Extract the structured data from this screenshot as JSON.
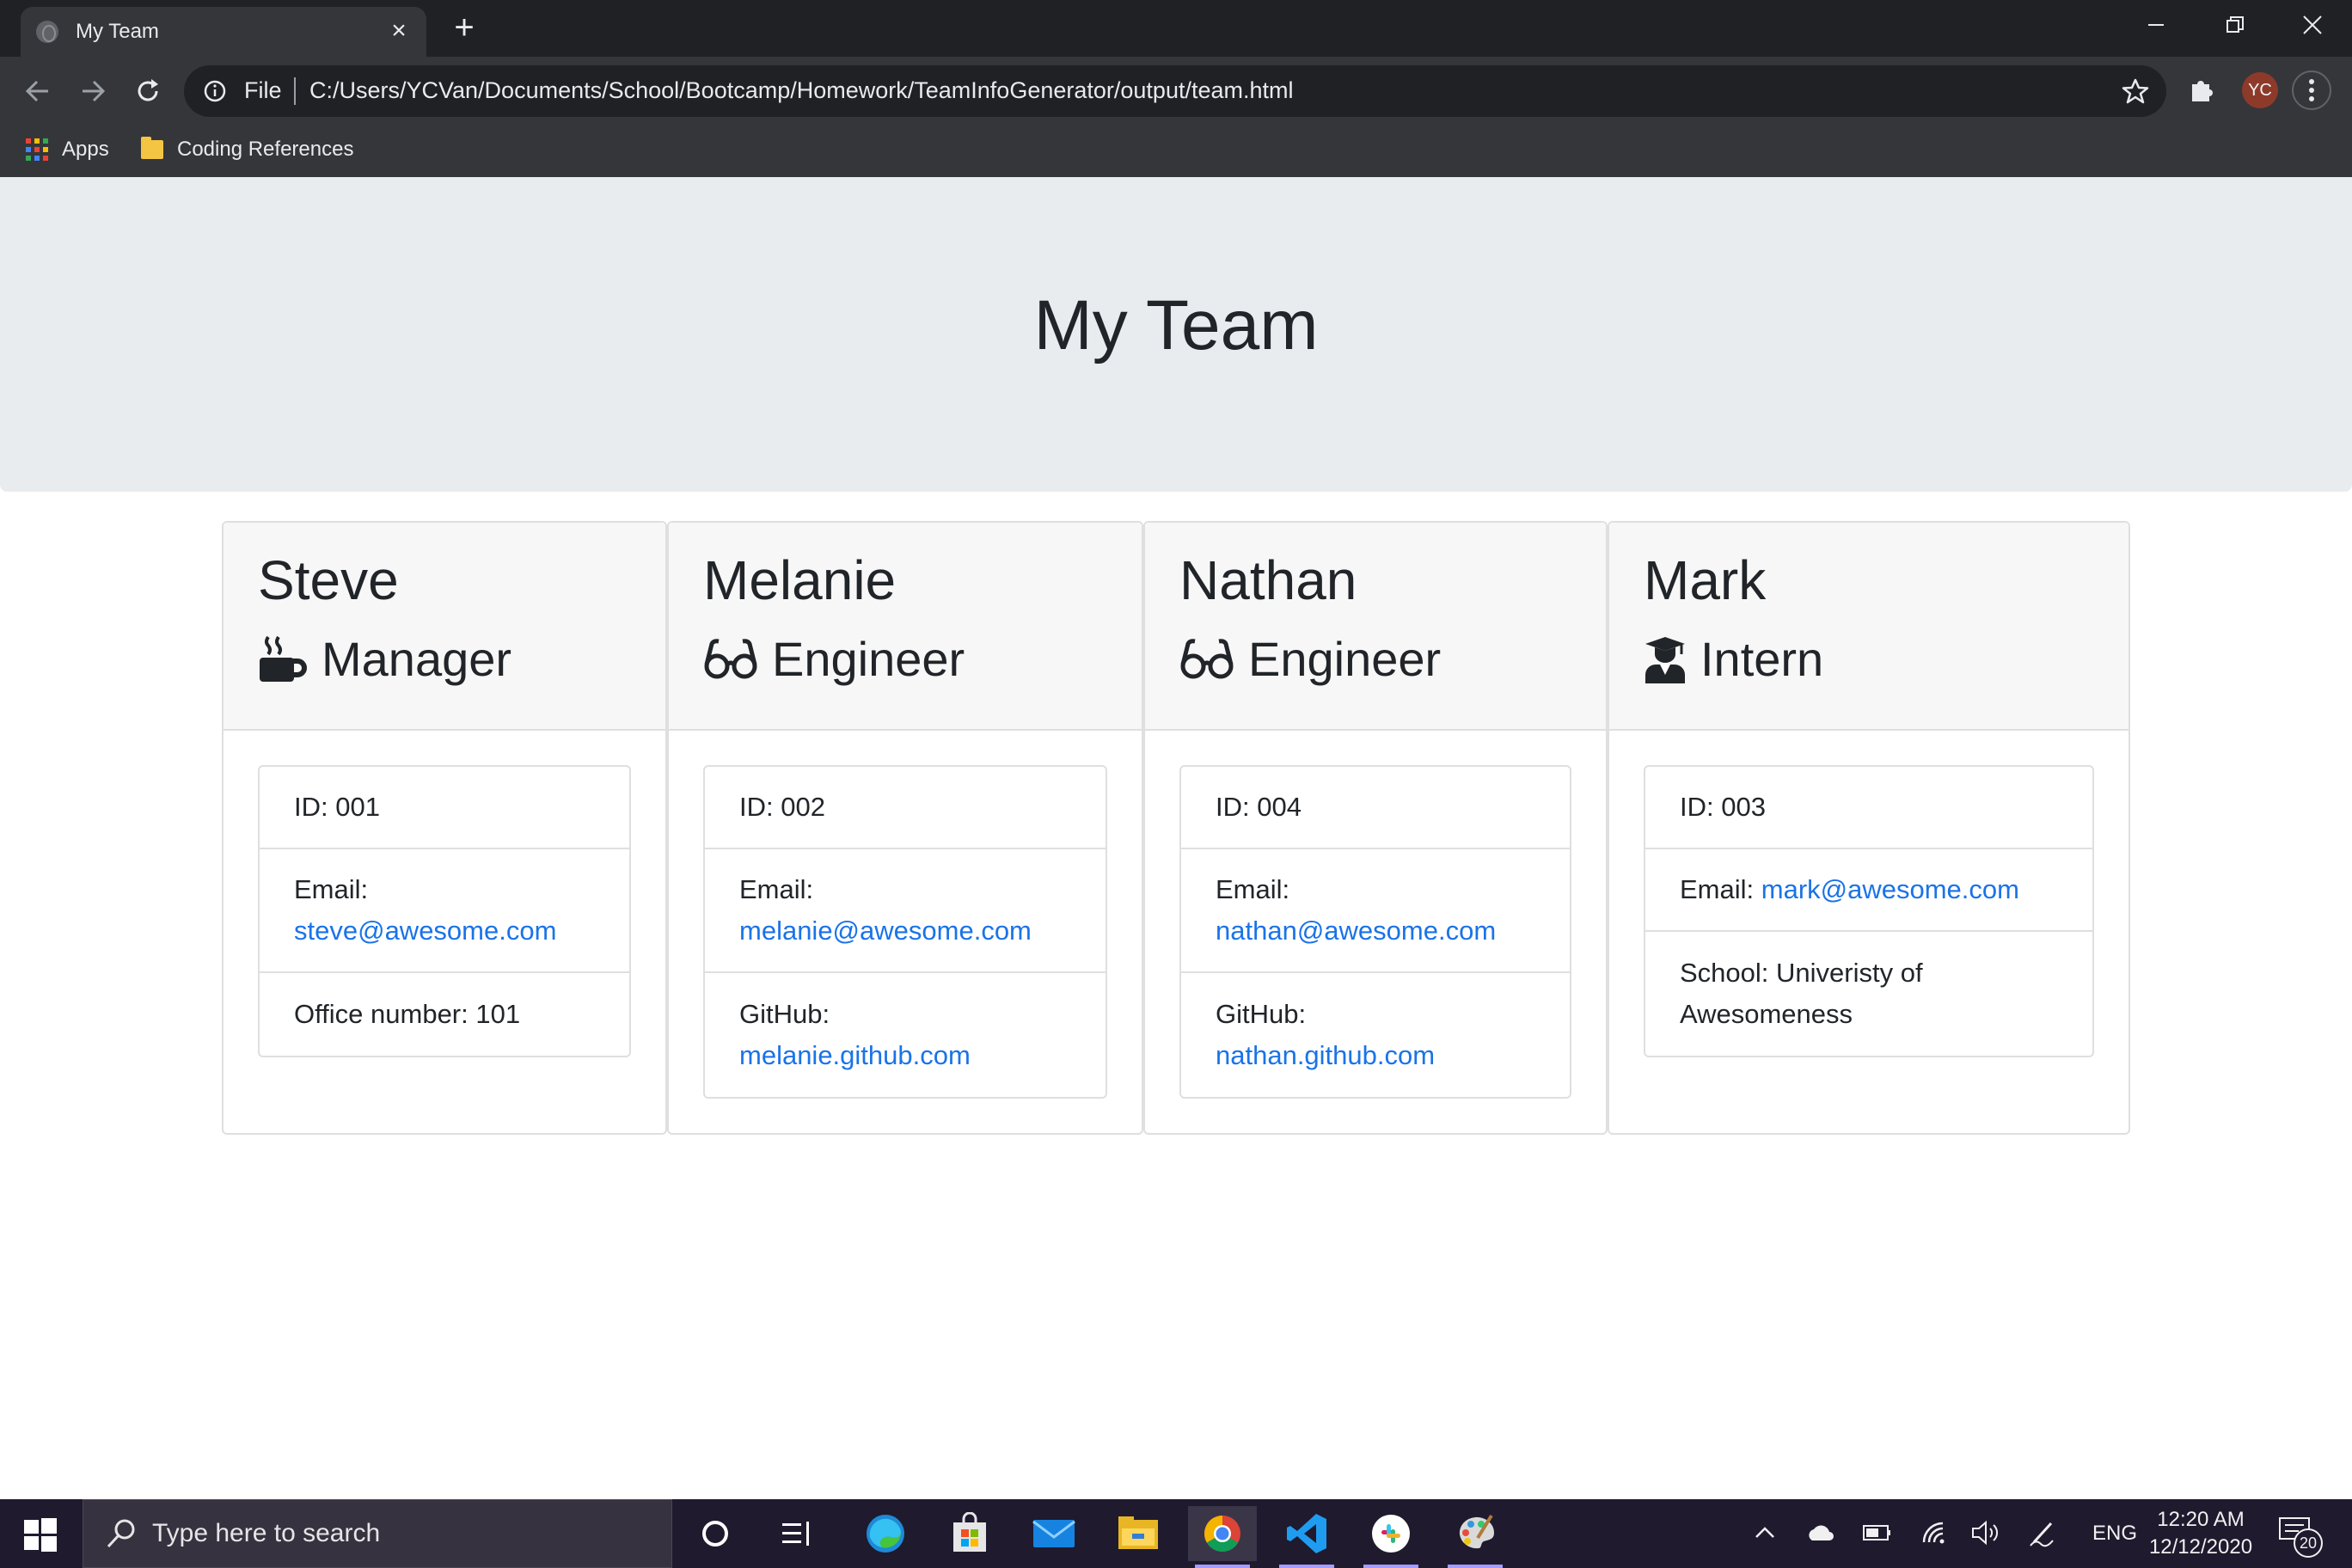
{
  "browser": {
    "tab_title": "My Team",
    "file_label": "File",
    "url": "C:/Users/YCVan/Documents/School/Bootcamp/Homework/TeamInfoGenerator/output/team.html",
    "profile_initials": "YC",
    "bookmarks": [
      {
        "label": "Apps",
        "icon": "apps-grid-icon"
      },
      {
        "label": "Coding References",
        "icon": "folder-icon"
      }
    ]
  },
  "page": {
    "title": "My Team",
    "cards": [
      {
        "name": "Steve",
        "role": "Manager",
        "role_icon": "mug-icon",
        "id_text": "ID: 001",
        "email_label": "Email:",
        "email": "steve@awesome.com",
        "extra_label": "Office number: 101",
        "extra_value": ""
      },
      {
        "name": "Melanie",
        "role": "Engineer",
        "role_icon": "glasses-icon",
        "id_text": "ID: 002",
        "email_label": "Email:",
        "email": "melanie@awesome.com",
        "extra_label": "GitHub:",
        "extra_value": "melanie.github.com"
      },
      {
        "name": "Nathan",
        "role": "Engineer",
        "role_icon": "glasses-icon",
        "id_text": "ID: 004",
        "email_label": "Email:",
        "email": "nathan@awesome.com",
        "extra_label": "GitHub:",
        "extra_value": "nathan.github.com"
      },
      {
        "name": "Mark",
        "role": "Intern",
        "role_icon": "graduate-icon",
        "id_text": "ID: 003",
        "email_label": "Email:",
        "email": "mark@awesome.com",
        "extra_label": "School: Univeristy of Awesomeness",
        "extra_value": ""
      }
    ]
  },
  "taskbar": {
    "search_placeholder": "Type here to search",
    "language": "ENG",
    "time": "12:20 AM",
    "date": "12/12/2020",
    "notification_count": "20"
  },
  "colors": {
    "link": "#1a73e8",
    "jumbotron_bg": "#e9ecef",
    "card_header_bg": "#f7f7f7",
    "browser_dark": "#202124",
    "taskbar_bg": "#1f1a2e"
  }
}
